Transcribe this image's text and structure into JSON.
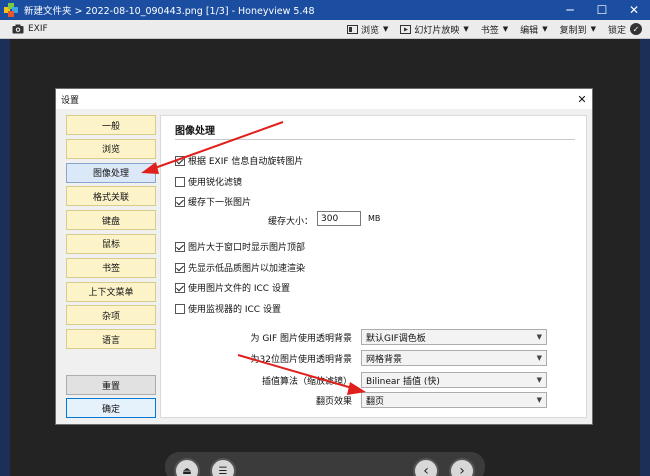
{
  "window": {
    "title": "新建文件夹 > 2022-08-10_090443.png [1/3] - Honeyview 5.48",
    "minimize": "─",
    "maximize": "☐",
    "close": "✕"
  },
  "toolbar": {
    "exif_label": "EXIF",
    "browse_label": "浏览",
    "slideshow_label": "幻灯片放映",
    "bookmark_label": "书签",
    "edit_label": "编辑",
    "copy_label": "复制到",
    "lock_label": "锁定"
  },
  "dialog": {
    "title": "设置",
    "close": "✕",
    "nav_items": [
      {
        "label": "一般"
      },
      {
        "label": "浏览"
      },
      {
        "label": "图像处理"
      },
      {
        "label": "格式关联"
      },
      {
        "label": "键盘"
      },
      {
        "label": "鼠标"
      },
      {
        "label": "书签"
      },
      {
        "label": "上下文菜单"
      },
      {
        "label": "杂项"
      },
      {
        "label": "语言"
      }
    ],
    "reset_label": "重置",
    "ok_label": "确定",
    "panel": {
      "title": "图像处理",
      "checkboxes": [
        {
          "label": "根据 EXIF 信息自动旋转图片",
          "checked": true
        },
        {
          "label": "使用锐化滤镜",
          "checked": false
        },
        {
          "label": "缓存下一张图片",
          "checked": true
        },
        {
          "label": "图片大于窗口时显示图片顶部",
          "checked": true
        },
        {
          "label": "先显示低品质图片以加速渲染",
          "checked": true
        },
        {
          "label": "使用图片文件的 ICC 设置",
          "checked": true
        },
        {
          "label": "使用监视器的 ICC 设置",
          "checked": false
        }
      ],
      "cache_label": "缓存大小：",
      "cache_value": "300",
      "cache_unit": "MB",
      "selects": [
        {
          "label": "为 GIF 图片使用透明背景",
          "value": "默认GIF调色板"
        },
        {
          "label": "为32位图片使用透明背景",
          "value": "网格背景"
        },
        {
          "label": "插值算法（缩放滤镜）",
          "value": "Bilinear 插值 (快)"
        },
        {
          "label": "翻页效果",
          "value": "翻页"
        }
      ]
    }
  },
  "bottom_controls": {
    "eject": "⏏",
    "menu": "☰",
    "prev": "‹",
    "next": "›"
  },
  "colors": {
    "titlebar": "#1b4ea1",
    "nav_item_bg": "#fdf3c9",
    "nav_active_bg": "#dbe8f7",
    "arrow_red": "#e0201c",
    "ok_border": "#0078d7"
  }
}
